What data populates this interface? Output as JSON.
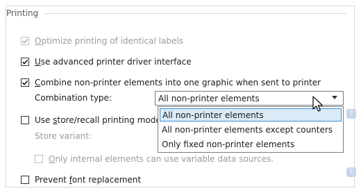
{
  "section": {
    "title": "Printing"
  },
  "options": {
    "optimize": {
      "pre": "",
      "ul": "O",
      "post": "ptimize printing of identical labels",
      "checked": true,
      "enabled": false
    },
    "advanced_driver": {
      "pre": "",
      "ul": "U",
      "post": "se advanced printer driver interface",
      "checked": true,
      "enabled": true
    },
    "combine": {
      "pre": "",
      "ul": "C",
      "post": "ombine non-printer elements into one graphic when sent to printer",
      "checked": true,
      "enabled": true
    },
    "store_recall": {
      "pre": "Use ",
      "ul": "s",
      "post": "tore/recall printing mode",
      "checked": false,
      "enabled": true
    },
    "only_internal": {
      "pre": "",
      "ul": "O",
      "post": "nly internal elements can use variable data sources.",
      "checked": false,
      "enabled": false
    },
    "font_replacement": {
      "pre": "Prevent ",
      "ul": "f",
      "post": "ont replacement",
      "checked": false,
      "enabled": true
    }
  },
  "combination": {
    "label": "Combination type:",
    "selected": "All non-printer elements",
    "options": [
      "All non-printer elements",
      "All non-printer elements except counters",
      "Only fixed non-printer elements"
    ],
    "highlighted_index": 0
  },
  "store_variant": {
    "label": "Store variant:"
  },
  "icons": {
    "check": "check-icon",
    "dropdown": "chevron-down-icon",
    "help": "help-icon",
    "cursor": "mouse-cursor-icon"
  },
  "colors": {
    "highlight_bg": "#dbeaf7",
    "highlight_border": "#3c8fd9",
    "help_icon": "#c8d8ea"
  }
}
